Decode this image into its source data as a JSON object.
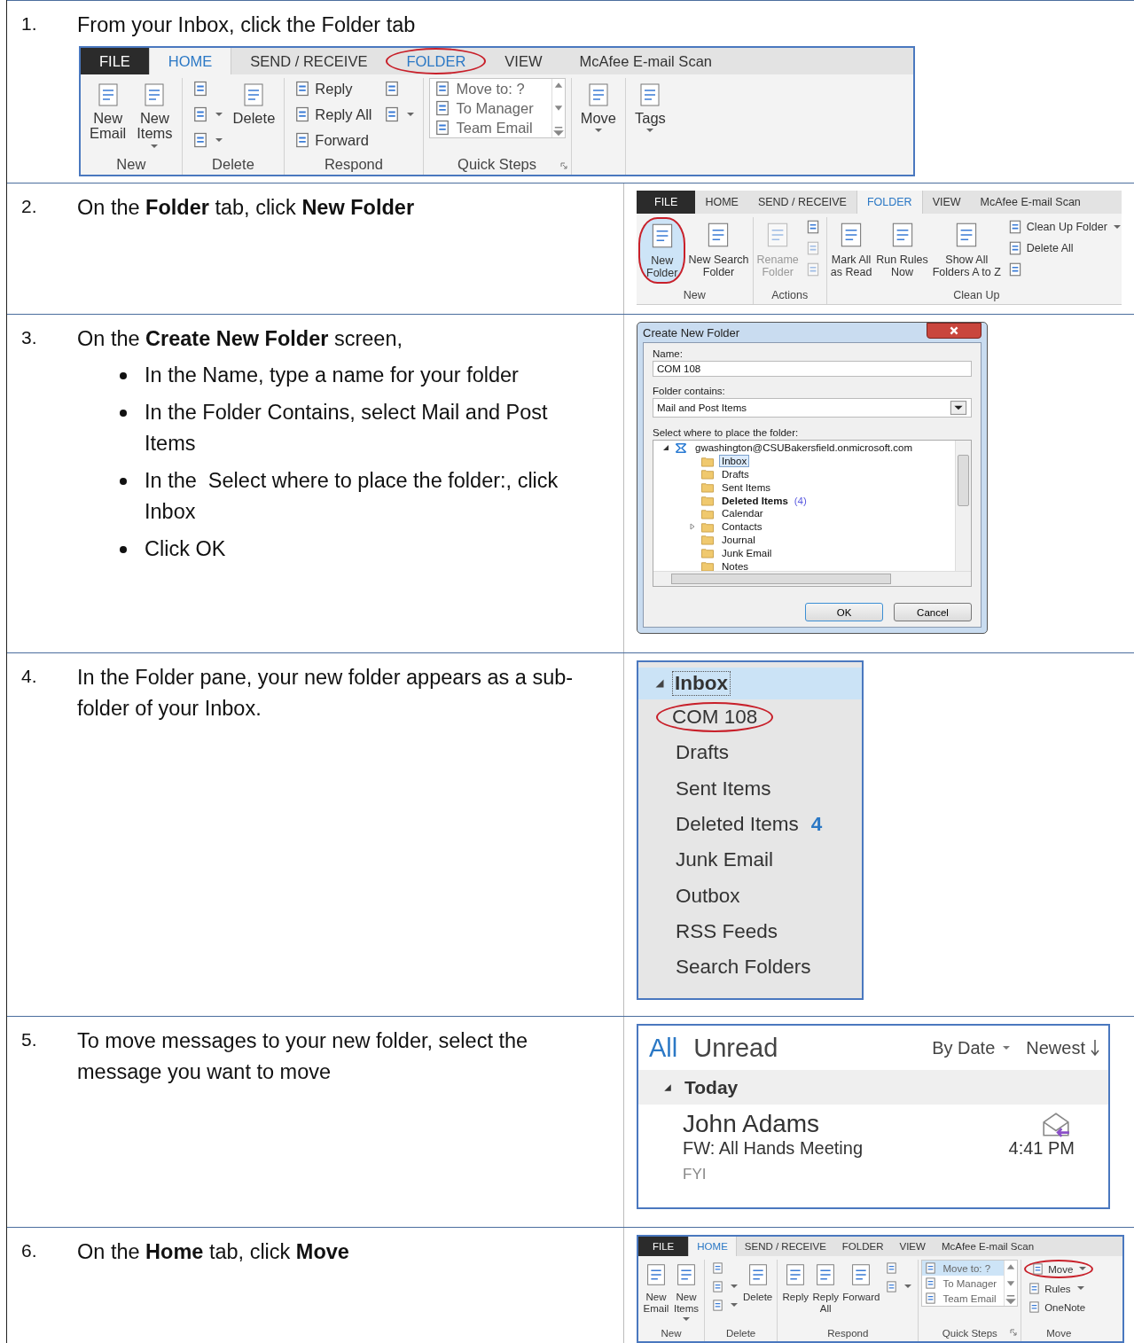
{
  "steps": [
    {
      "number": "1.",
      "kind": "stacked",
      "text": "From your Inbox, click the Folder tab",
      "screenshot": {
        "kind": "ribbon",
        "tabs": [
          {
            "label": "FILE",
            "kind": "file",
            "selected": false,
            "circled": false
          },
          {
            "label": "HOME",
            "kind": "tab",
            "selected": true,
            "circled": false
          },
          {
            "label": "SEND / RECEIVE",
            "kind": "tab",
            "selected": false,
            "circled": false
          },
          {
            "label": "FOLDER",
            "kind": "tab",
            "selected": false,
            "circled": true
          },
          {
            "label": "VIEW",
            "kind": "tab",
            "selected": false,
            "circled": false
          },
          {
            "label": "McAfee E-mail Scan",
            "kind": "tab",
            "selected": false,
            "circled": false
          }
        ],
        "groups": [
          {
            "label": "New",
            "launcher": false,
            "items": [
              {
                "kind": "large",
                "lines": [
                  "New",
                  "Email"
                ],
                "dropdown": false,
                "circled": false,
                "highlighted": false,
                "disabled": false
              },
              {
                "kind": "large",
                "lines": [
                  "New",
                  "Items"
                ],
                "dropdown": true,
                "circled": false,
                "highlighted": false,
                "disabled": false
              }
            ]
          },
          {
            "label": "Delete",
            "launcher": false,
            "items": [
              {
                "kind": "stack",
                "items": [
                  {
                    "kind": "icon",
                    "dropdown": false,
                    "disabled": false,
                    "circled": false
                  },
                  {
                    "kind": "icon",
                    "dropdown": true,
                    "disabled": false,
                    "circled": false
                  },
                  {
                    "kind": "icon",
                    "dropdown": true,
                    "disabled": false,
                    "circled": false
                  }
                ]
              },
              {
                "kind": "large",
                "lines": [
                  "Delete"
                ],
                "dropdown": false,
                "circled": false,
                "highlighted": false,
                "disabled": false
              }
            ]
          },
          {
            "label": "Respond",
            "launcher": false,
            "items": [
              {
                "kind": "stack",
                "items": [
                  {
                    "kind": "small",
                    "label": "Reply",
                    "dropdown": false,
                    "disabled": false,
                    "circled": false
                  },
                  {
                    "kind": "small",
                    "label": "Reply All",
                    "dropdown": false,
                    "disabled": false,
                    "circled": false
                  },
                  {
                    "kind": "small",
                    "label": "Forward",
                    "dropdown": false,
                    "disabled": false,
                    "circled": false
                  }
                ]
              },
              {
                "kind": "stack",
                "items": [
                  {
                    "kind": "icon",
                    "dropdown": false,
                    "disabled": false,
                    "circled": false
                  },
                  {
                    "kind": "icon",
                    "dropdown": true,
                    "disabled": false,
                    "circled": false
                  }
                ]
              }
            ]
          },
          {
            "label": "Quick Steps",
            "launcher": true,
            "items": [
              {
                "kind": "gallery",
                "entries": [
                  {
                    "label": "Move to: ?",
                    "highlighted": false
                  },
                  {
                    "label": "To Manager",
                    "highlighted": false
                  },
                  {
                    "label": "Team Email",
                    "highlighted": false
                  }
                ]
              }
            ]
          },
          {
            "launcher": false,
            "items": [
              {
                "kind": "large",
                "lines": [
                  "Move"
                ],
                "dropdown": true,
                "circled": false,
                "highlighted": false,
                "disabled": false
              }
            ]
          },
          {
            "launcher": false,
            "items": [
              {
                "kind": "large",
                "lines": [
                  "Tags"
                ],
                "dropdown": true,
                "circled": false,
                "highlighted": false,
                "disabled": false
              }
            ]
          }
        ]
      }
    },
    {
      "number": "2.",
      "kind": "side",
      "text": "On the **Folder** tab, click **New Folder**",
      "screenshot": {
        "kind": "ribbon",
        "tabs": [
          {
            "label": "FILE",
            "kind": "file",
            "selected": false,
            "circled": false
          },
          {
            "label": "HOME",
            "kind": "tab",
            "selected": false,
            "circled": false
          },
          {
            "label": "SEND / RECEIVE",
            "kind": "tab",
            "selected": false,
            "circled": false
          },
          {
            "label": "FOLDER",
            "kind": "tab",
            "selected": true,
            "circled": false
          },
          {
            "label": "VIEW",
            "kind": "tab",
            "selected": false,
            "circled": false
          },
          {
            "label": "McAfee E-mail Scan",
            "kind": "tab",
            "selected": false,
            "circled": false
          }
        ],
        "groups": [
          {
            "label": "New",
            "launcher": false,
            "items": [
              {
                "kind": "large",
                "lines": [
                  "New",
                  "Folder"
                ],
                "dropdown": false,
                "circled": true,
                "highlighted": true,
                "disabled": false
              },
              {
                "kind": "large",
                "lines": [
                  "New Search",
                  "Folder"
                ],
                "dropdown": false,
                "circled": false,
                "highlighted": false,
                "disabled": false
              }
            ]
          },
          {
            "label": "Actions",
            "launcher": false,
            "items": [
              {
                "kind": "large",
                "lines": [
                  "Rename",
                  "Folder"
                ],
                "dropdown": false,
                "circled": false,
                "highlighted": false,
                "disabled": true
              },
              {
                "kind": "stack",
                "items": [
                  {
                    "kind": "icon",
                    "dropdown": false,
                    "disabled": false,
                    "circled": false
                  },
                  {
                    "kind": "icon",
                    "dropdown": false,
                    "disabled": true,
                    "circled": false
                  },
                  {
                    "kind": "icon",
                    "dropdown": false,
                    "disabled": true,
                    "circled": false
                  }
                ]
              }
            ]
          },
          {
            "label": "Clean Up",
            "launcher": false,
            "items": [
              {
                "kind": "large",
                "lines": [
                  "Mark All",
                  "as Read"
                ],
                "dropdown": false,
                "circled": false,
                "highlighted": false,
                "disabled": false
              },
              {
                "kind": "large",
                "lines": [
                  "Run Rules",
                  "Now"
                ],
                "dropdown": false,
                "circled": false,
                "highlighted": false,
                "disabled": false
              },
              {
                "kind": "large",
                "lines": [
                  "Show All",
                  "Folders A to Z"
                ],
                "dropdown": false,
                "circled": false,
                "highlighted": false,
                "disabled": false
              },
              {
                "kind": "stack",
                "items": [
                  {
                    "kind": "small",
                    "label": "Clean Up Folder",
                    "dropdown": true,
                    "disabled": false,
                    "circled": false
                  },
                  {
                    "kind": "small",
                    "label": "Delete All",
                    "dropdown": false,
                    "disabled": false,
                    "circled": false
                  },
                  {
                    "kind": "icon",
                    "dropdown": false,
                    "disabled": false,
                    "circled": false
                  }
                ]
              }
            ]
          }
        ]
      }
    },
    {
      "number": "3.",
      "kind": "side",
      "text": "On the **Create New Folder** screen,",
      "bullets": [
        "In the Name, type a name for your folder",
        "In the Folder Contains, select Mail and Post Items",
        "In the  Select where to place the folder:, click Inbox",
        "Click OK"
      ],
      "screenshot": {
        "kind": "dialog",
        "title": "Create New Folder",
        "name_label": "Name:",
        "name_value": "COM 108",
        "contains_label": "Folder contains:",
        "contains_value": "Mail and Post Items",
        "place_label": "Select where to place the folder:",
        "tree": [
          {
            "label": "gwashington@CSUBakersfield.onmicrosoft.com",
            "kind": "account",
            "expanded": true,
            "selected": false,
            "children": [
              {
                "label": "Inbox",
                "kind": "folder",
                "selected": true,
                "bold": false
              },
              {
                "label": "Drafts",
                "kind": "folder",
                "selected": false,
                "bold": false
              },
              {
                "label": "Sent Items",
                "kind": "folder",
                "selected": false,
                "bold": false
              },
              {
                "label": "Deleted Items",
                "count": "(4)",
                "kind": "folder",
                "selected": false,
                "bold": true
              },
              {
                "label": "Calendar",
                "kind": "folder",
                "selected": false,
                "bold": false
              },
              {
                "label": "Contacts",
                "kind": "folder",
                "expanded": false,
                "selected": false,
                "bold": false
              },
              {
                "label": "Journal",
                "kind": "folder",
                "selected": false,
                "bold": false
              },
              {
                "label": "Junk Email",
                "kind": "folder",
                "selected": false,
                "bold": false
              },
              {
                "label": "Notes",
                "kind": "folder",
                "selected": false,
                "bold": false
              }
            ]
          }
        ],
        "buttons": [
          {
            "label": "OK",
            "kind": "default"
          },
          {
            "label": "Cancel",
            "kind": "normal"
          }
        ]
      }
    },
    {
      "number": "4.",
      "kind": "side",
      "text": "In the Folder pane, your new folder appears as a sub-folder of your Inbox.",
      "screenshot": {
        "kind": "folder_pane",
        "folders": [
          {
            "label": "Inbox",
            "expanded": true,
            "selected": true,
            "circled": false,
            "children": [
              {
                "label": "COM 108",
                "selected": false,
                "circled": true
              }
            ]
          },
          {
            "label": "Drafts",
            "selected": false,
            "circled": false
          },
          {
            "label": "Sent Items",
            "selected": false,
            "circled": false
          },
          {
            "label": "Deleted Items",
            "count": "4",
            "selected": false,
            "circled": false
          },
          {
            "label": "Junk Email",
            "selected": false,
            "circled": false
          },
          {
            "label": "Outbox",
            "selected": false,
            "circled": false
          },
          {
            "label": "RSS Feeds",
            "selected": false,
            "circled": false
          },
          {
            "label": "Search Folders",
            "selected": false,
            "circled": false
          }
        ]
      }
    },
    {
      "number": "5.",
      "kind": "side",
      "text": "To move messages to your new folder, select the message you want to move",
      "screenshot": {
        "kind": "message_list",
        "filters": [
          {
            "label": "All",
            "selected": true
          },
          {
            "label": "Unread",
            "selected": false
          }
        ],
        "sort": "By Date",
        "order": "Newest",
        "groups": [
          {
            "label": "Today",
            "expanded": true,
            "messages": [
              {
                "sender": "John Adams",
                "subject": "FW: All Hands Meeting",
                "preview": "FYI",
                "time": "4:41 PM"
              }
            ]
          }
        ]
      }
    },
    {
      "number": "6.",
      "kind": "side",
      "text": "On the **Home** tab, click **Move**",
      "screenshot": {
        "kind": "ribbon",
        "tabs": [
          {
            "label": "FILE",
            "kind": "file",
            "selected": false,
            "circled": false
          },
          {
            "label": "HOME",
            "kind": "tab",
            "selected": true,
            "circled": false
          },
          {
            "label": "SEND / RECEIVE",
            "kind": "tab",
            "selected": false,
            "circled": false
          },
          {
            "label": "FOLDER",
            "kind": "tab",
            "selected": false,
            "circled": false
          },
          {
            "label": "VIEW",
            "kind": "tab",
            "selected": false,
            "circled": false
          },
          {
            "label": "McAfee E-mail Scan",
            "kind": "tab",
            "selected": false,
            "circled": false
          }
        ],
        "groups": [
          {
            "label": "New",
            "launcher": false,
            "items": [
              {
                "kind": "large",
                "lines": [
                  "New",
                  "Email"
                ],
                "dropdown": false,
                "circled": false,
                "highlighted": false,
                "disabled": false
              },
              {
                "kind": "large",
                "lines": [
                  "New",
                  "Items"
                ],
                "dropdown": true,
                "circled": false,
                "highlighted": false,
                "disabled": false
              }
            ]
          },
          {
            "label": "Delete",
            "launcher": false,
            "items": [
              {
                "kind": "stack",
                "items": [
                  {
                    "kind": "icon",
                    "dropdown": false,
                    "disabled": false,
                    "circled": false
                  },
                  {
                    "kind": "icon",
                    "dropdown": true,
                    "disabled": false,
                    "circled": false
                  },
                  {
                    "kind": "icon",
                    "dropdown": true,
                    "disabled": false,
                    "circled": false
                  }
                ]
              },
              {
                "kind": "large",
                "lines": [
                  "Delete"
                ],
                "dropdown": false,
                "circled": false,
                "highlighted": false,
                "disabled": false
              }
            ]
          },
          {
            "label": "Respond",
            "launcher": false,
            "items": [
              {
                "kind": "large",
                "lines": [
                  "Reply"
                ],
                "dropdown": false,
                "circled": false,
                "highlighted": false,
                "disabled": false
              },
              {
                "kind": "large",
                "lines": [
                  "Reply",
                  "All"
                ],
                "dropdown": false,
                "circled": false,
                "highlighted": false,
                "disabled": false
              },
              {
                "kind": "large",
                "lines": [
                  "Forward"
                ],
                "dropdown": false,
                "circled": false,
                "highlighted": false,
                "disabled": false
              },
              {
                "kind": "stack",
                "items": [
                  {
                    "kind": "icon",
                    "dropdown": false,
                    "disabled": false,
                    "circled": false
                  },
                  {
                    "kind": "icon",
                    "dropdown": true,
                    "disabled": false,
                    "circled": false
                  }
                ]
              }
            ]
          },
          {
            "label": "Quick Steps",
            "launcher": true,
            "items": [
              {
                "kind": "gallery",
                "entries": [
                  {
                    "label": "Move to: ?",
                    "highlighted": true
                  },
                  {
                    "label": "To Manager",
                    "highlighted": false
                  },
                  {
                    "label": "Team Email",
                    "highlighted": false
                  }
                ]
              }
            ]
          },
          {
            "label": "Move",
            "launcher": false,
            "items": [
              {
                "kind": "stack",
                "items": [
                  {
                    "kind": "small",
                    "label": "Move",
                    "dropdown": true,
                    "disabled": false,
                    "circled": true
                  },
                  {
                    "kind": "small",
                    "label": "Rules",
                    "dropdown": true,
                    "disabled": false,
                    "circled": false
                  },
                  {
                    "kind": "small",
                    "label": "OneNote",
                    "dropdown": false,
                    "disabled": false,
                    "circled": false
                  }
                ]
              }
            ]
          }
        ]
      }
    }
  ]
}
